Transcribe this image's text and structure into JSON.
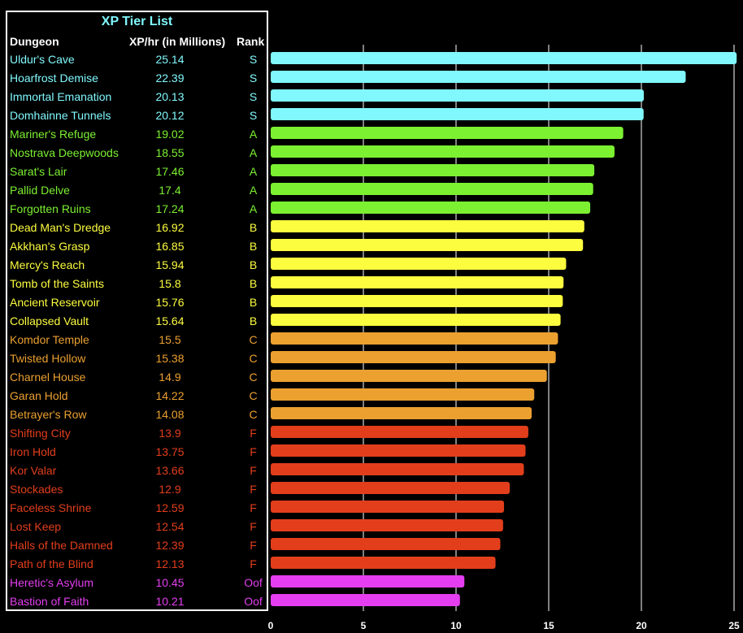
{
  "chart_data": {
    "type": "bar",
    "orientation": "horizontal",
    "title": "XP Tier List",
    "xlabel": "",
    "ylabel": "",
    "xlim": [
      0,
      25
    ],
    "x_ticks": [
      0,
      5,
      10,
      15,
      20,
      25
    ],
    "grid": "vertical",
    "table_headers": [
      "Dungeon",
      "XP/hr (in Millions)",
      "Rank"
    ],
    "tier_colors": {
      "S": "#80f8fd",
      "A": "#7cf131",
      "B": "#fdfd3f",
      "C": "#eba030",
      "F": "#e23e1c",
      "Oof": "#e43ef0"
    },
    "rows": [
      {
        "name": "Uldur's Cave",
        "value": 25.14,
        "rank": "S"
      },
      {
        "name": "Hoarfrost Demise",
        "value": 22.39,
        "rank": "S"
      },
      {
        "name": "Immortal Emanation",
        "value": 20.13,
        "rank": "S"
      },
      {
        "name": "Domhainne Tunnels",
        "value": 20.12,
        "rank": "S"
      },
      {
        "name": "Mariner's Refuge",
        "value": 19.02,
        "rank": "A"
      },
      {
        "name": "Nostrava Deepwoods",
        "value": 18.55,
        "rank": "A"
      },
      {
        "name": "Sarat's Lair",
        "value": 17.46,
        "rank": "A"
      },
      {
        "name": "Pallid Delve",
        "value": 17.4,
        "rank": "A"
      },
      {
        "name": "Forgotten Ruins",
        "value": 17.24,
        "rank": "A"
      },
      {
        "name": "Dead Man's Dredge",
        "value": 16.92,
        "rank": "B"
      },
      {
        "name": "Akkhan's Grasp",
        "value": 16.85,
        "rank": "B"
      },
      {
        "name": "Mercy's Reach",
        "value": 15.94,
        "rank": "B"
      },
      {
        "name": "Tomb of the Saints",
        "value": 15.8,
        "rank": "B"
      },
      {
        "name": "Ancient Reservoir",
        "value": 15.76,
        "rank": "B"
      },
      {
        "name": "Collapsed Vault",
        "value": 15.64,
        "rank": "B"
      },
      {
        "name": "Komdor Temple",
        "value": 15.5,
        "rank": "C"
      },
      {
        "name": "Twisted Hollow",
        "value": 15.38,
        "rank": "C"
      },
      {
        "name": "Charnel House",
        "value": 14.9,
        "rank": "C"
      },
      {
        "name": "Garan Hold",
        "value": 14.22,
        "rank": "C"
      },
      {
        "name": "Betrayer's Row",
        "value": 14.08,
        "rank": "C"
      },
      {
        "name": "Shifting City",
        "value": 13.9,
        "rank": "F"
      },
      {
        "name": "Iron Hold",
        "value": 13.75,
        "rank": "F"
      },
      {
        "name": "Kor Valar",
        "value": 13.66,
        "rank": "F"
      },
      {
        "name": "Stockades",
        "value": 12.9,
        "rank": "F"
      },
      {
        "name": "Faceless Shrine",
        "value": 12.59,
        "rank": "F"
      },
      {
        "name": "Lost Keep",
        "value": 12.54,
        "rank": "F"
      },
      {
        "name": "Halls of the Damned",
        "value": 12.39,
        "rank": "F"
      },
      {
        "name": "Path of the Blind",
        "value": 12.13,
        "rank": "F"
      },
      {
        "name": "Heretic's Asylum",
        "value": 10.45,
        "rank": "Oof"
      },
      {
        "name": "Bastion of Faith",
        "value": 10.21,
        "rank": "Oof"
      }
    ]
  }
}
